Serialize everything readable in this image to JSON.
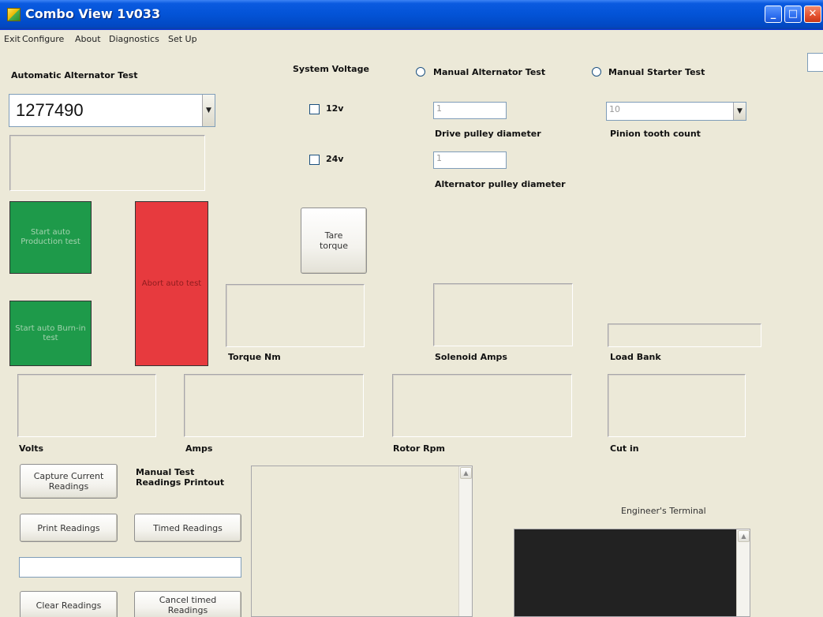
{
  "window": {
    "title": "Combo View 1v033",
    "minimize_glyph": "_",
    "maximize_glyph": "□",
    "close_glyph": "✕"
  },
  "menu": {
    "items": [
      "Exit",
      "Configure",
      "About",
      "Diagnostics",
      "Set Up"
    ]
  },
  "auto_test": {
    "label": "Automatic Alternator Test",
    "part_number": "1277490",
    "start_production_label": "Start auto Production test",
    "start_burnin_label": "Start auto Burn-in test",
    "abort_label": "Abort auto test"
  },
  "system_voltage": {
    "label": "System Voltage",
    "option_12v": "12v",
    "option_24v": "24v",
    "tare_label": "Tare torque"
  },
  "manual_alternator": {
    "label": "Manual Alternator Test",
    "drive_pulley_value": "1",
    "drive_pulley_label": "Drive pulley diameter",
    "alt_pulley_value": "1",
    "alt_pulley_label": "Alternator pulley diameter"
  },
  "manual_starter": {
    "label": "Manual Starter Test",
    "pinion_value": "10",
    "pinion_label": "Pinion tooth count"
  },
  "readouts": {
    "torque_label": "Torque Nm",
    "solenoid_label": "Solenoid Amps",
    "loadbank_label": "Load Bank",
    "volts_label": "Volts",
    "amps_label": "Amps",
    "rotor_label": "Rotor Rpm",
    "cutin_label": "Cut in"
  },
  "manual_readings": {
    "capture_label": "Capture Current Readings",
    "printout_label": "Manual Test Readings Printout",
    "print_label": "Print Readings",
    "timed_label": "Timed Readings",
    "clear_label": "Clear Readings",
    "cancel_timed_label": "Cancel timed Readings"
  },
  "terminal": {
    "label": "Engineer's Terminal"
  },
  "icons": {
    "dropdown": "▼",
    "scroll_up": "▲"
  },
  "colors": {
    "start_button": "#1e9a4a",
    "abort_button": "#e73a3e",
    "terminal_bg": "#222222",
    "titlebar": "#0353d6"
  }
}
